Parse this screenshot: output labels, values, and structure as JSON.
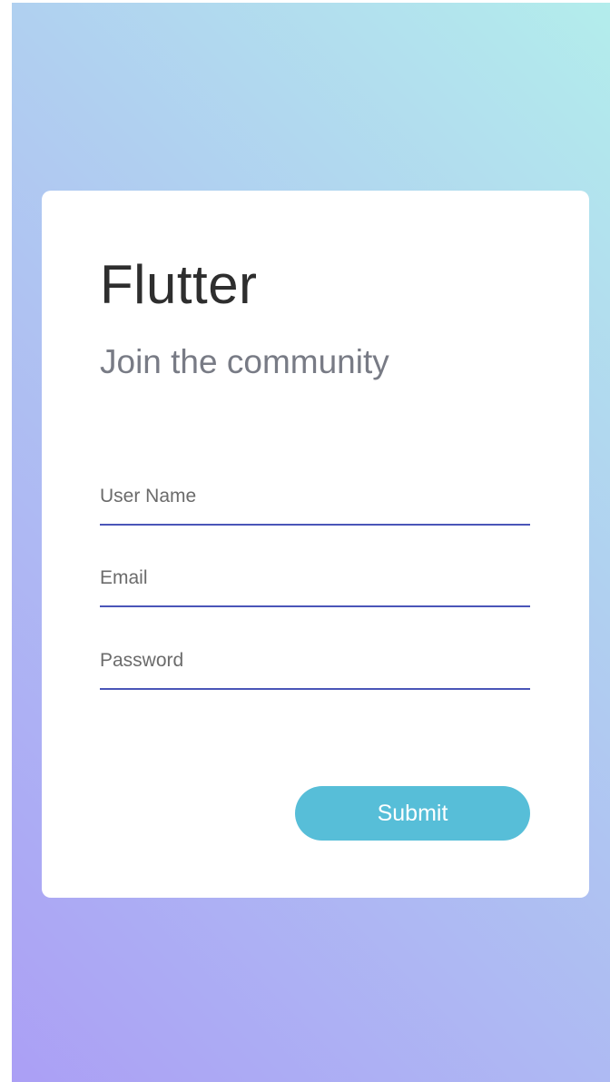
{
  "card": {
    "title": "Flutter",
    "subtitle": "Join the community"
  },
  "form": {
    "fields": [
      {
        "label": "User Name"
      },
      {
        "label": "Email"
      },
      {
        "label": "Password"
      }
    ],
    "submit_label": "Submit"
  },
  "colors": {
    "gradient_start": "#ab9ff5",
    "gradient_end": "#b3edec",
    "underline": "#4a55b8",
    "button": "#57bed8"
  }
}
